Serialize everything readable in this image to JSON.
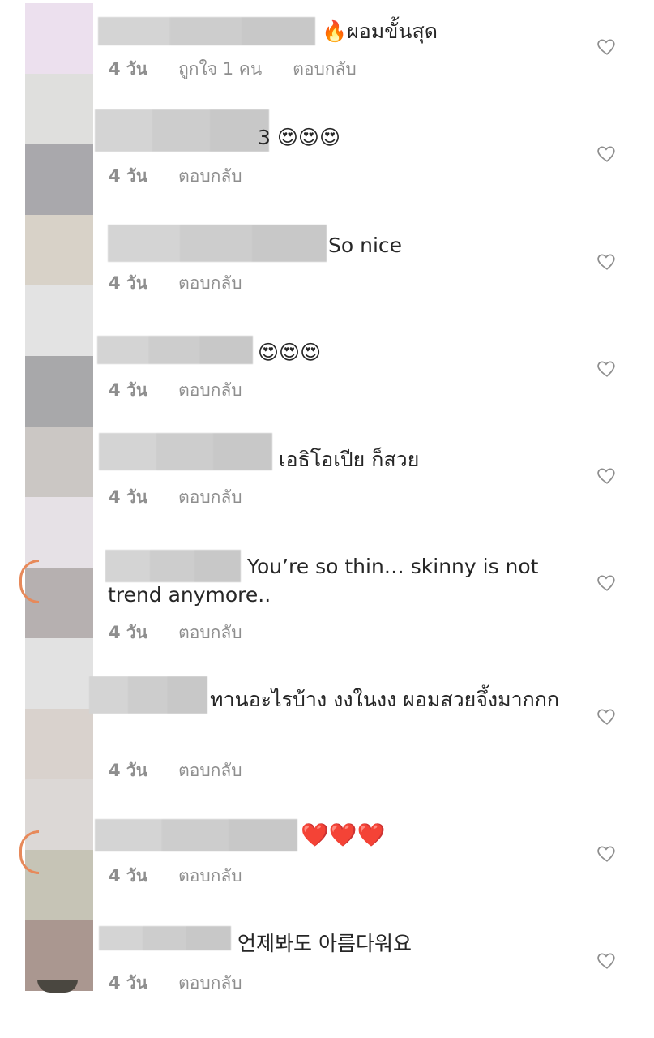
{
  "avatars": [
    "#ece0ee",
    "#dfdfdd",
    "#a9a8ac",
    "#d8d2c8",
    "#e3e3e3",
    "#a8a8aa",
    "#cbc7c4",
    "#e6e1e6",
    "#b6b0b0",
    "#e2e2e2",
    "#d9d2cd",
    "#dcd8d6",
    "#c6c4b6",
    "#aa9790"
  ],
  "comments": [
    {
      "text": "🔥ผอมขั้นสุด",
      "time": "4 วัน",
      "likes_label": "ถูกใจ 1 คน",
      "reply": "ตอบกลับ"
    },
    {
      "text": "3 😍😍😍",
      "time": "4 วัน",
      "reply": "ตอบกลับ"
    },
    {
      "text": "So nice",
      "time": "4 วัน",
      "reply": "ตอบกลับ"
    },
    {
      "text": "😍😍😍",
      "time": "4 วัน",
      "reply": "ตอบกลับ"
    },
    {
      "text": "เอธิโอเปีย ก็สวย",
      "time": "4 วัน",
      "reply": "ตอบกลับ"
    },
    {
      "text": "You’re so thin… skinny is not trend anymore..",
      "time": "4 วัน",
      "reply": "ตอบกลับ"
    },
    {
      "text": "ทานอะไรบ้าง งงในงง ผอมสวยจึ้งมากกก",
      "time": "4 วัน",
      "reply": "ตอบกลับ"
    },
    {
      "text": "❤️❤️❤️",
      "time": "4 วัน",
      "reply": "ตอบกลับ"
    },
    {
      "text": "언제봐도 아름다워요",
      "time": "4 วัน",
      "reply": "ตอบกลับ"
    }
  ],
  "icons": {
    "like": "heart-outline-icon"
  },
  "colors": {
    "text": "#262626",
    "meta": "#8e8e8e",
    "heart_outline": "#8e8e8e",
    "story_ring": "#e7895a"
  }
}
